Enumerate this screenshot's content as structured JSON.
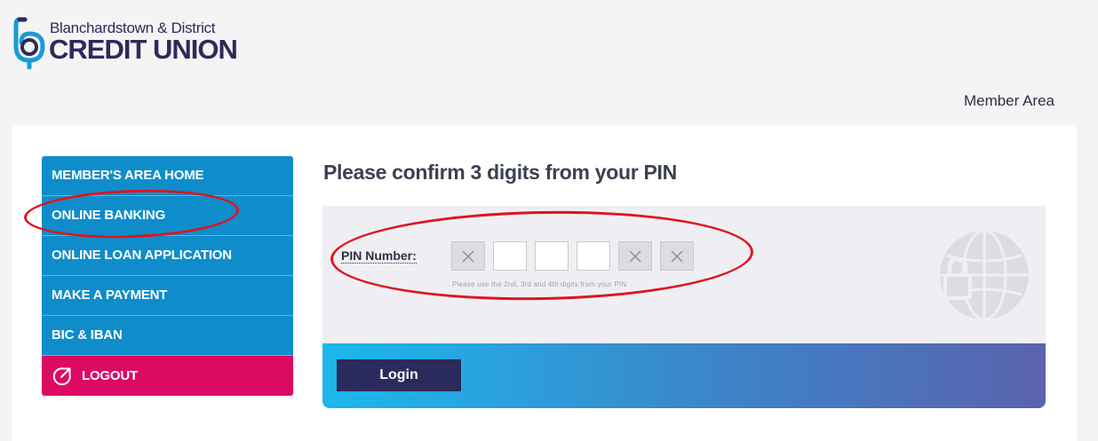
{
  "brand": {
    "line1": "Blanchardstown & District",
    "line2": "CREDIT UNION",
    "colors": {
      "navy": "#2d2a5a",
      "blue": "#0f8dca",
      "pink": "#dc0a63"
    }
  },
  "header": {
    "member_area_link": "Member Area"
  },
  "sidebar": {
    "items": [
      {
        "label": "MEMBER'S AREA HOME"
      },
      {
        "label": "ONLINE BANKING"
      },
      {
        "label": "ONLINE LOAN APPLICATION"
      },
      {
        "label": "MAKE A PAYMENT"
      },
      {
        "label": "BIC & IBAN"
      }
    ],
    "logout": {
      "label": "LOGOUT",
      "icon": "logout-arrow-icon"
    }
  },
  "main": {
    "title": "Please confirm 3 digits from your PIN",
    "pin": {
      "label": "PIN Number:",
      "digits": [
        {
          "state": "disabled",
          "icon": "x-icon"
        },
        {
          "state": "input",
          "value": ""
        },
        {
          "state": "input",
          "value": ""
        },
        {
          "state": "input",
          "value": ""
        },
        {
          "state": "disabled",
          "icon": "x-icon"
        },
        {
          "state": "disabled",
          "icon": "x-icon"
        }
      ],
      "hint": "Please use the 2nd, 3rd and 4th digits from your PIN"
    },
    "login_label": "Login"
  }
}
